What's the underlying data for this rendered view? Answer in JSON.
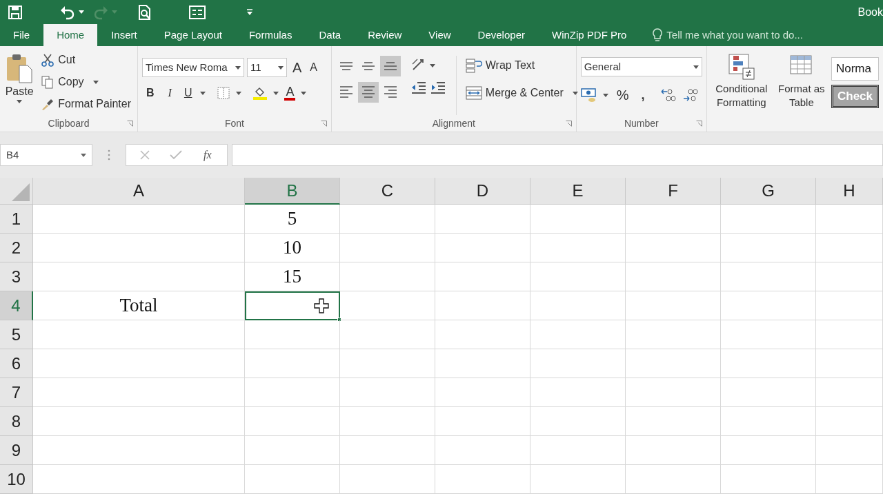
{
  "title_bar": {
    "title": "Book"
  },
  "tabs": [
    {
      "label": "File",
      "selected": false
    },
    {
      "label": "Home",
      "selected": true
    },
    {
      "label": "Insert",
      "selected": false
    },
    {
      "label": "Page Layout",
      "selected": false
    },
    {
      "label": "Formulas",
      "selected": false
    },
    {
      "label": "Data",
      "selected": false
    },
    {
      "label": "Review",
      "selected": false
    },
    {
      "label": "View",
      "selected": false
    },
    {
      "label": "Developer",
      "selected": false
    },
    {
      "label": "WinZip PDF Pro",
      "selected": false
    }
  ],
  "tell_me": {
    "placeholder": "Tell me what you want to do..."
  },
  "ribbon": {
    "clipboard": {
      "label": "Clipboard",
      "paste": "Paste",
      "cut": "Cut",
      "copy": "Copy",
      "format_painter": "Format Painter"
    },
    "font": {
      "label": "Font",
      "font_name": "Times New Roma",
      "font_size": "11",
      "grow": "A",
      "shrink": "A",
      "bold": "B",
      "italic": "I",
      "underline": "U",
      "font_color": "A"
    },
    "alignment": {
      "label": "Alignment",
      "vertical": [
        {
          "kind": "top",
          "selected": false
        },
        {
          "kind": "middle",
          "selected": false
        },
        {
          "kind": "bottom",
          "selected": true
        }
      ],
      "horizontal": [
        {
          "kind": "left",
          "selected": false
        },
        {
          "kind": "center",
          "selected": true
        },
        {
          "kind": "right",
          "selected": false
        }
      ],
      "wrap_text": "Wrap Text",
      "merge_center": "Merge & Center"
    },
    "number": {
      "label": "Number",
      "format": "General",
      "percent": "%",
      "comma": ","
    },
    "styles": {
      "conditional_formatting": "Conditional Formatting",
      "format_as_table": "Format as Table",
      "cell_styles": [
        "Norma",
        "Check"
      ]
    }
  },
  "formula_bar": {
    "name_box": "B4",
    "fx": "fx"
  },
  "sheet": {
    "columns": [
      {
        "label": "A",
        "selected": false
      },
      {
        "label": "B",
        "selected": true
      },
      {
        "label": "C",
        "selected": false
      },
      {
        "label": "D",
        "selected": false
      },
      {
        "label": "E",
        "selected": false
      },
      {
        "label": "F",
        "selected": false
      },
      {
        "label": "G",
        "selected": false
      },
      {
        "label": "H",
        "selected": false
      }
    ],
    "rows": [
      {
        "label": "1",
        "selected": false,
        "cells": [
          null,
          "5",
          null,
          null,
          null,
          null,
          null,
          null
        ]
      },
      {
        "label": "2",
        "selected": false,
        "cells": [
          null,
          "10",
          null,
          null,
          null,
          null,
          null,
          null
        ]
      },
      {
        "label": "3",
        "selected": false,
        "cells": [
          null,
          "15",
          null,
          null,
          null,
          null,
          null,
          null
        ]
      },
      {
        "label": "4",
        "selected": true,
        "cells": [
          "Total",
          null,
          null,
          null,
          null,
          null,
          null,
          null
        ]
      },
      {
        "label": "5",
        "selected": false,
        "cells": [
          null,
          null,
          null,
          null,
          null,
          null,
          null,
          null
        ]
      },
      {
        "label": "6",
        "selected": false,
        "cells": [
          null,
          null,
          null,
          null,
          null,
          null,
          null,
          null
        ]
      },
      {
        "label": "7",
        "selected": false,
        "cells": [
          null,
          null,
          null,
          null,
          null,
          null,
          null,
          null
        ]
      },
      {
        "label": "8",
        "selected": false,
        "cells": [
          null,
          null,
          null,
          null,
          null,
          null,
          null,
          null
        ]
      },
      {
        "label": "9",
        "selected": false,
        "cells": [
          null,
          null,
          null,
          null,
          null,
          null,
          null,
          null
        ]
      },
      {
        "label": "10",
        "selected": false,
        "cells": [
          null,
          null,
          null,
          null,
          null,
          null,
          null,
          null
        ]
      }
    ]
  }
}
